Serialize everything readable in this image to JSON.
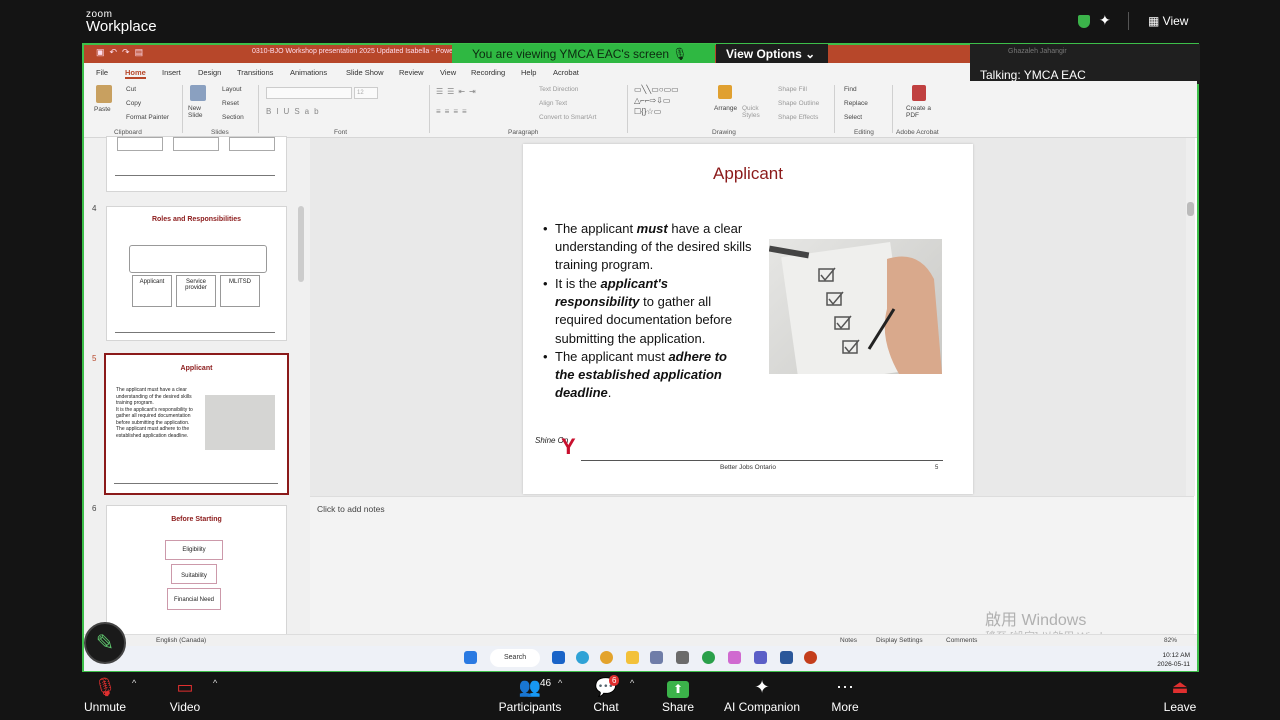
{
  "zoom": {
    "logo_top": "zoom",
    "logo_bottom": "Workplace",
    "view_label": "View",
    "banner": "You are viewing  YMCA EAC's screen",
    "view_options": "View Options",
    "talking": "Talking: YMCA EAC",
    "talking_name": "Ghazaleh Jahangir",
    "toolbar": {
      "unmute": "Unmute",
      "video": "Video",
      "participants": "Participants",
      "participants_count": "46",
      "chat": "Chat",
      "chat_badge": "6",
      "share": "Share",
      "ai": "AI Companion",
      "more": "More",
      "leave": "Leave"
    }
  },
  "ppt": {
    "title": "0310-BJO Workshop presentation 2025 Updated Isabella  -  PowerPoint",
    "menu": [
      "File",
      "Home",
      "Insert",
      "Design",
      "Transitions",
      "Animations",
      "Slide Show",
      "Review",
      "View",
      "Recording",
      "Help",
      "Acrobat"
    ],
    "ribbon": {
      "paste": "Paste",
      "cut": "Cut",
      "copy": "Copy",
      "format_painter": "Format Painter",
      "new_slide": "New Slide",
      "layout": "Layout",
      "reset": "Reset",
      "section": "Section",
      "text_direction": "Text Direction",
      "align_text": "Align Text",
      "convert_smartart": "Convert to SmartArt",
      "arrange": "Arrange",
      "quick_styles": "Quick Styles",
      "shape_fill": "Shape Fill",
      "shape_outline": "Shape Outline",
      "shape_effects": "Shape Effects",
      "find": "Find",
      "replace": "Replace",
      "select": "Select",
      "create_pdf": "Create a PDF",
      "groups": [
        "Clipboard",
        "Slides",
        "Font",
        "Paragraph",
        "Drawing",
        "Editing",
        "Adobe Acrobat"
      ],
      "font_size": "12"
    },
    "thumbnails": [
      {
        "num": "4",
        "title": "Roles and Responsibilities",
        "boxes": [
          "Applicant",
          "Service provider",
          "MLITSD"
        ]
      },
      {
        "num": "5",
        "title": "Applicant",
        "bullets": [
          "The applicant must have a clear understanding of the desired skills training program.",
          "It is the applicant's responsibility to gather all required documentation before submitting the application.",
          "The applicant must adhere to the established application deadline."
        ]
      },
      {
        "num": "6",
        "title": "Before Starting",
        "boxes": [
          "Eligibility",
          "Suitability",
          "Financial Need"
        ]
      }
    ],
    "slide": {
      "title": "Applicant",
      "b1_pre": "The applicant ",
      "b1_em": "must",
      "b1_post": " have a clear understanding of the desired skills training program.",
      "b2_pre": "It is the ",
      "b2_em": "applicant's responsibility",
      "b2_post": " to gather all required documentation before submitting the application.",
      "b3_pre": "The applicant must ",
      "b3_em": "adhere to the established application deadline",
      "b3_post": ".",
      "footer": "Better Jobs Ontario",
      "page": "5",
      "logo_text": "Shine On"
    },
    "notes_placeholder": "Click to add notes",
    "status": {
      "language": "English (Canada)",
      "notes": "Notes",
      "display": "Display Settings",
      "comments": "Comments",
      "zoom": "82%"
    }
  },
  "windows": {
    "search": "Search",
    "time": "10:12 AM",
    "date": "2026-05-11",
    "watermark1": "啟用 Windows",
    "watermark2": "移至 [設定] 以啟用 Windows。"
  }
}
